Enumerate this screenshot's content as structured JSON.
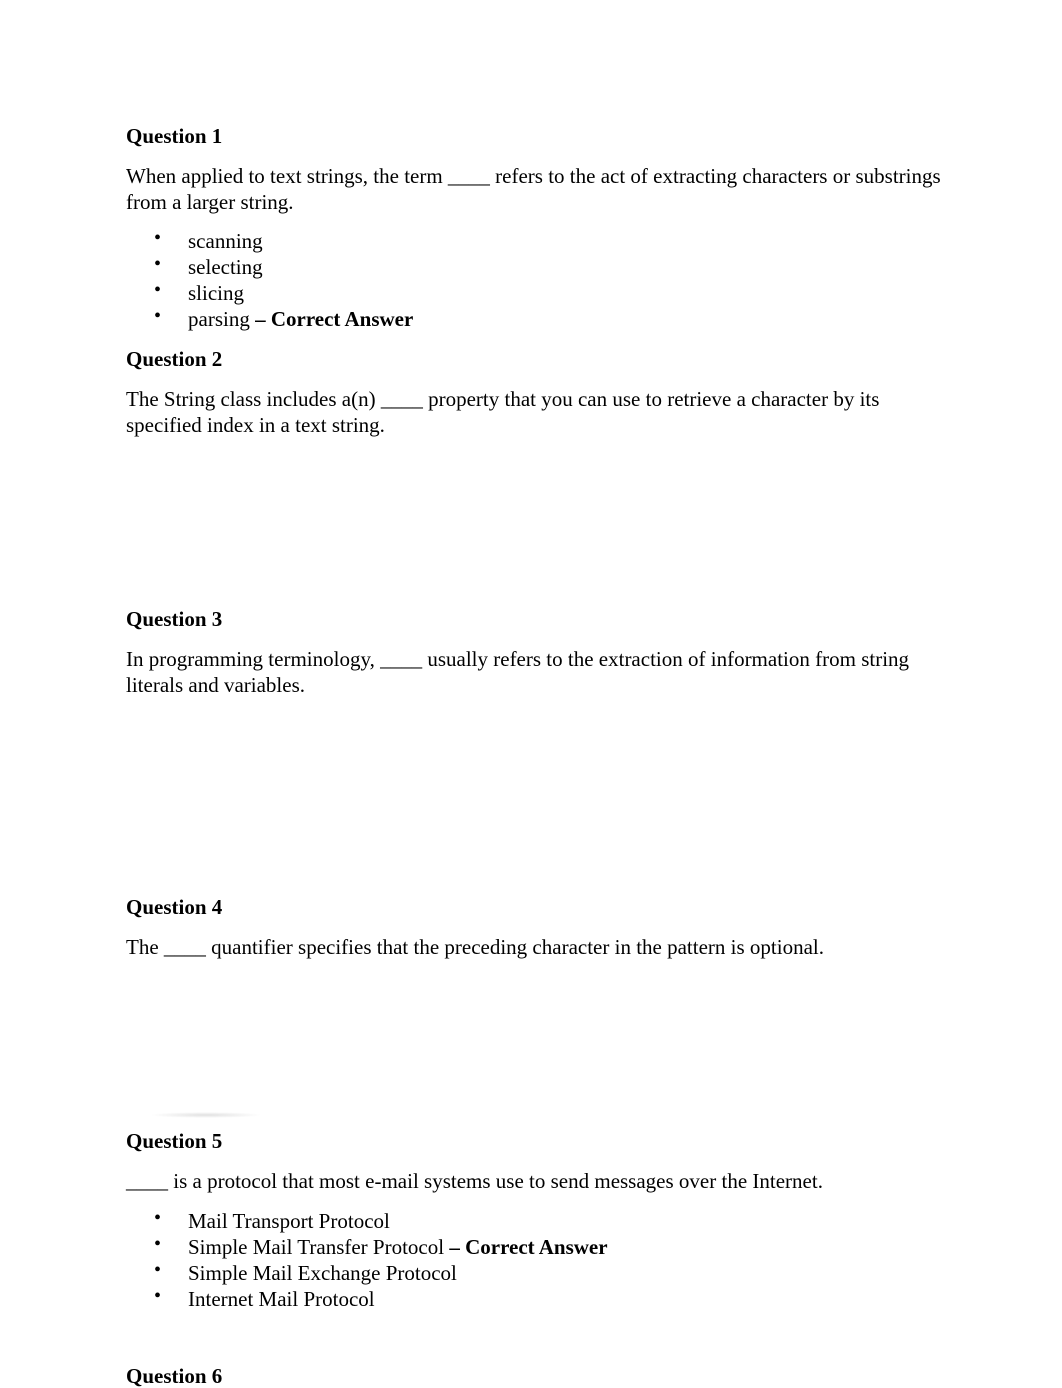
{
  "questions": [
    {
      "title": "Question 1",
      "text": "When applied to text strings, the term ____ refers to the act of extracting characters or substrings from a larger string.",
      "options": [
        {
          "label": "scanning",
          "suffix": ""
        },
        {
          "label": "selecting",
          "suffix": ""
        },
        {
          "label": "slicing",
          "suffix": ""
        },
        {
          "label": "parsing",
          "suffix": " – Correct Answer"
        }
      ]
    },
    {
      "title": "Question 2",
      "text": "The String class includes a(n) ____ property that you can use to retrieve a character by its specified index in a text string.",
      "options": []
    },
    {
      "title": "Question 3",
      "text": "In programming terminology, ____ usually refers to the extraction of information from string literals and variables.",
      "options": []
    },
    {
      "title": "Question 4",
      "text": "The ____ quantifier specifies that the preceding character in the pattern is optional.",
      "options": []
    },
    {
      "title": "Question 5",
      "text": "____ is a protocol that most e-mail systems use to send messages over the Internet.",
      "options": [
        {
          "label": "Mail Transport Protocol",
          "suffix": ""
        },
        {
          "label": "Simple Mail Transfer Protocol",
          "suffix": " – Correct Answer"
        },
        {
          "label": "Simple Mail Exchange Protocol",
          "suffix": ""
        },
        {
          "label": "Internet Mail Protocol",
          "suffix": ""
        }
      ]
    },
    {
      "title": "Question 6",
      "text": "",
      "options": []
    }
  ],
  "bullet_glyph": "•"
}
